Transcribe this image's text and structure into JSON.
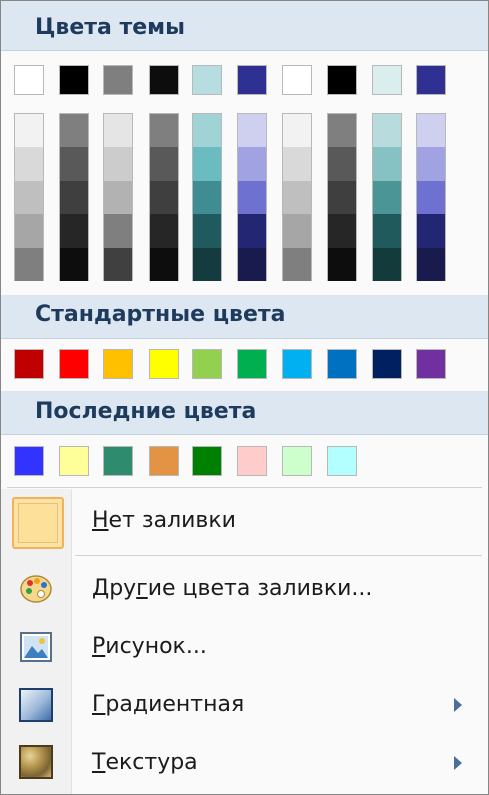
{
  "sections": {
    "theme": "Цвета темы",
    "standard": "Стандартные цвета",
    "recent": "Последние цвета"
  },
  "theme_top": [
    "#ffffff",
    "#000000",
    "#7f7f7f",
    "#0d0d0d",
    "#b7dde0",
    "#2e3192",
    "#ffffff",
    "#000000",
    "#dbeeee",
    "#2e3192"
  ],
  "theme_shades": [
    [
      "#f2f2f2",
      "#d9d9d9",
      "#bfbfbf",
      "#a6a6a6",
      "#7f7f7f"
    ],
    [
      "#7f7f7f",
      "#595959",
      "#3f3f3f",
      "#262626",
      "#0d0d0d"
    ],
    [
      "#e5e5e5",
      "#cccccc",
      "#b2b2b2",
      "#7f7f7f",
      "#404040"
    ],
    [
      "#7f7f7f",
      "#595959",
      "#3f3f3f",
      "#262626",
      "#0d0d0d"
    ],
    [
      "#9fd3d6",
      "#6bbcc1",
      "#3f8d93",
      "#1f5a5e",
      "#143b3e"
    ],
    [
      "#cfd0f0",
      "#a0a2e1",
      "#6e71cf",
      "#232673",
      "#191a4d"
    ],
    [
      "#f2f2f2",
      "#d9d9d9",
      "#bfbfbf",
      "#a6a6a6",
      "#7f7f7f"
    ],
    [
      "#7f7f7f",
      "#595959",
      "#3f3f3f",
      "#262626",
      "#0d0d0d"
    ],
    [
      "#b8dcdd",
      "#86c2c4",
      "#4c9597",
      "#205a5c",
      "#133b3c"
    ],
    [
      "#cfd0f0",
      "#a0a2e1",
      "#6e71cf",
      "#232673",
      "#191a4d"
    ]
  ],
  "standard_colors": [
    "#c00000",
    "#ff0000",
    "#ffc000",
    "#ffff00",
    "#92d050",
    "#00b050",
    "#00b0f0",
    "#0070c0",
    "#002060",
    "#7030a0"
  ],
  "recent_colors": [
    "#3333ff",
    "#ffff99",
    "#2e8b6e",
    "#e39344",
    "#008000",
    "#ffcccc",
    "#ccffcc",
    "#b3ffff"
  ],
  "items": {
    "no_fill": {
      "accel": "Н",
      "rest": "ет заливки"
    },
    "more_colors": {
      "pre": "Дру",
      "accel": "г",
      "rest": "ие цвета заливки..."
    },
    "picture": {
      "accel": "Р",
      "rest": "исунок..."
    },
    "gradient": {
      "accel": "Г",
      "rest": "радиентная"
    },
    "texture": {
      "accel": "Т",
      "rest": "екстура"
    }
  },
  "icons": {
    "no_fill": "no-fill-swatch-icon",
    "more_colors": "palette-icon",
    "picture": "picture-icon",
    "gradient": "gradient-icon",
    "texture": "texture-icon"
  }
}
